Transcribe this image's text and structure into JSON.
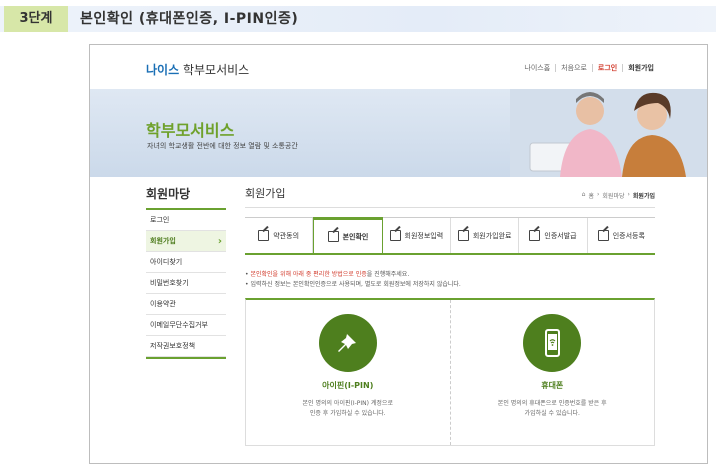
{
  "step": {
    "badge": "3단계",
    "title": "본인확인 (휴대폰인증, I-PIN인증)"
  },
  "header": {
    "brand": "나이스",
    "service": "학부모서비스",
    "nav": [
      "나이스홈",
      "처음으로",
      "로그인",
      "회원가입"
    ]
  },
  "banner": {
    "title": "학부모서비스",
    "subtitle": "자녀의 학교생활 전반에 대한 정보 열람 및 소통공간"
  },
  "sidebar": {
    "title": "회원마당",
    "items": [
      {
        "label": "로그인",
        "active": false
      },
      {
        "label": "회원가입",
        "active": true
      },
      {
        "label": "아이디찾기",
        "active": false
      },
      {
        "label": "비밀번호찾기",
        "active": false
      },
      {
        "label": "이용약관",
        "active": false
      },
      {
        "label": "이메일무단수집거부",
        "active": false
      },
      {
        "label": "저작권보호정책",
        "active": false
      }
    ]
  },
  "main": {
    "title": "회원가입",
    "breadcrumb": [
      "홈",
      "회원마당",
      "회원가입"
    ],
    "tabs": [
      {
        "label": "약관동의",
        "icon": "checkbox-icon"
      },
      {
        "label": "본인확인",
        "icon": "checkbox-icon",
        "active": true
      },
      {
        "label": "회원정보입력",
        "icon": "edit-icon"
      },
      {
        "label": "회원가입완료",
        "icon": "document-icon"
      },
      {
        "label": "인증서발급",
        "icon": "certificate-icon"
      },
      {
        "label": "인증서등록",
        "icon": "register-icon"
      }
    ],
    "notes": {
      "line1_red": "본인확인을 위해 아래 중 편리한 방법으로 인증",
      "line1_rest": "을 진행해주세요.",
      "line2": "입력하신 정보는 본인확인인증으로 사용되며, 별도로 회원정보에 저장하지 않습니다."
    },
    "cards": [
      {
        "title": "아이핀(I-PIN)",
        "desc1": "본인 명의의 아이핀(I-PIN) 계정으로",
        "desc2": "인증 후 가입하실 수 있습니다.",
        "icon": "pin-icon"
      },
      {
        "title": "휴대폰",
        "desc1": "본인 명의의 휴대폰으로 인증번호를 받은 후",
        "desc2": "가입하실 수 있습니다.",
        "icon": "mobile-phone-icon"
      }
    ]
  },
  "colors": {
    "accent_green": "#6aa130",
    "dark_green": "#4e7f1e",
    "red": "#d23b2c",
    "brand_blue": "#1a6fb5"
  }
}
